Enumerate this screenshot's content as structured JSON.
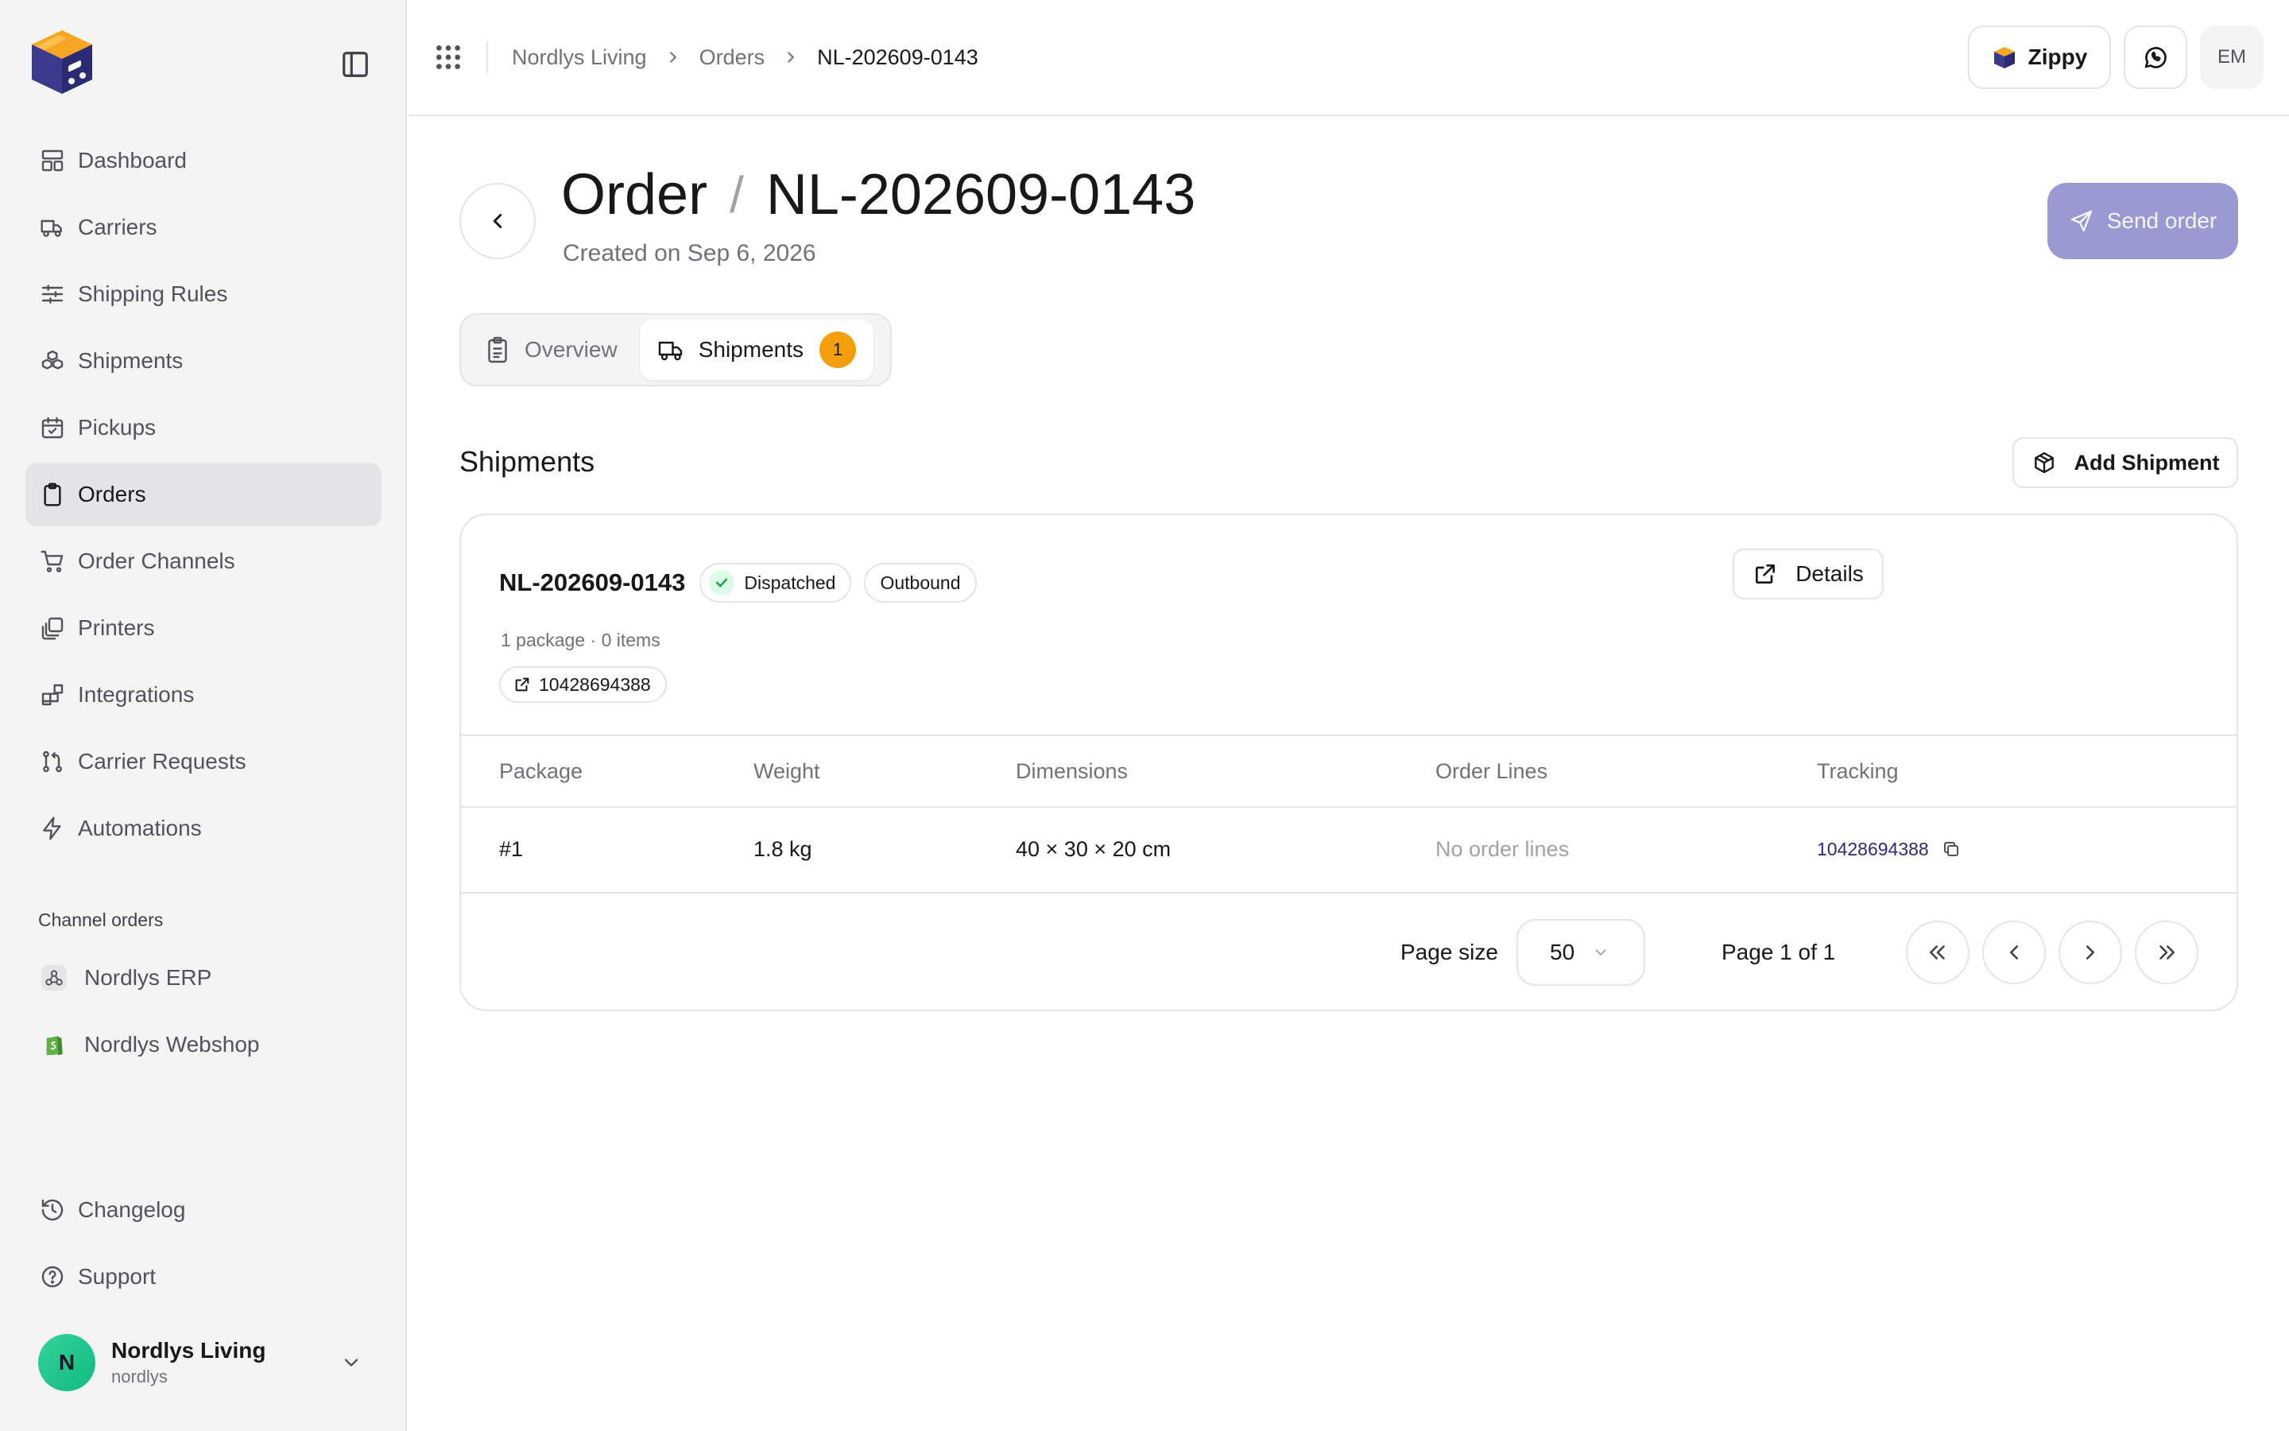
{
  "sidebar": {
    "logo": "carrier-app-logo",
    "nav": [
      {
        "label": "Dashboard",
        "icon": "dashboard-icon"
      },
      {
        "label": "Carriers",
        "icon": "truck-icon"
      },
      {
        "label": "Shipping Rules",
        "icon": "sliders-icon"
      },
      {
        "label": "Shipments",
        "icon": "boxes-icon"
      },
      {
        "label": "Pickups",
        "icon": "calendar-check-icon"
      },
      {
        "label": "Orders",
        "icon": "clipboard-icon",
        "active": true
      },
      {
        "label": "Order Channels",
        "icon": "cart-icon"
      },
      {
        "label": "Printers",
        "icon": "printer-icon"
      },
      {
        "label": "Integrations",
        "icon": "blocks-icon"
      },
      {
        "label": "Carrier Requests",
        "icon": "git-pull-request-icon"
      },
      {
        "label": "Automations",
        "icon": "lightning-icon"
      }
    ],
    "channel_section_label": "Channel orders",
    "channels": [
      {
        "label": "Nordlys ERP",
        "icon": "webhook-icon"
      },
      {
        "label": "Nordlys Webshop",
        "icon": "shopify-icon"
      }
    ],
    "bottom": [
      {
        "label": "Changelog",
        "icon": "history-icon"
      },
      {
        "label": "Support",
        "icon": "help-circle-icon"
      }
    ],
    "account": {
      "initial": "N",
      "name": "Nordlys Living",
      "handle": "nordlys"
    }
  },
  "topbar": {
    "breadcrumb": [
      "Nordlys Living",
      "Orders",
      "NL-202609-0143"
    ],
    "carrier_button": "Zippy",
    "user_initials": "EM"
  },
  "page": {
    "title_prefix": "Order",
    "title_sep": "/",
    "order_id": "NL-202609-0143",
    "created": "Created on Sep 6, 2026",
    "send_button": "Send order",
    "tabs": [
      {
        "label": "Overview",
        "icon": "clipboard-list-icon"
      },
      {
        "label": "Shipments",
        "icon": "truck-icon",
        "badge": "1",
        "active": true
      }
    ]
  },
  "shipments": {
    "section_title": "Shipments",
    "add_button": "Add Shipment",
    "card": {
      "id": "NL-202609-0143",
      "status": "Dispatched",
      "direction": "Outbound",
      "details_button": "Details",
      "meta": "1 package · 0 items",
      "tracking_number": "10428694388"
    },
    "table": {
      "headers": [
        "Package",
        "Weight",
        "Dimensions",
        "Order Lines",
        "Tracking"
      ],
      "rows": [
        {
          "package": "#1",
          "weight": "1.8 kg",
          "dimensions": "40 × 30 × 20 cm",
          "order_lines": "No order lines",
          "tracking": "10428694388"
        }
      ]
    },
    "pagination": {
      "page_size_label": "Page size",
      "page_size": "50",
      "page_of": "Page 1 of 1"
    }
  },
  "colors": {
    "accent": "#9b99d4",
    "badge": "#f59e0b",
    "success": "#16a34a",
    "avatar": "#10b981",
    "tracking_link": "#2e2a7a"
  }
}
